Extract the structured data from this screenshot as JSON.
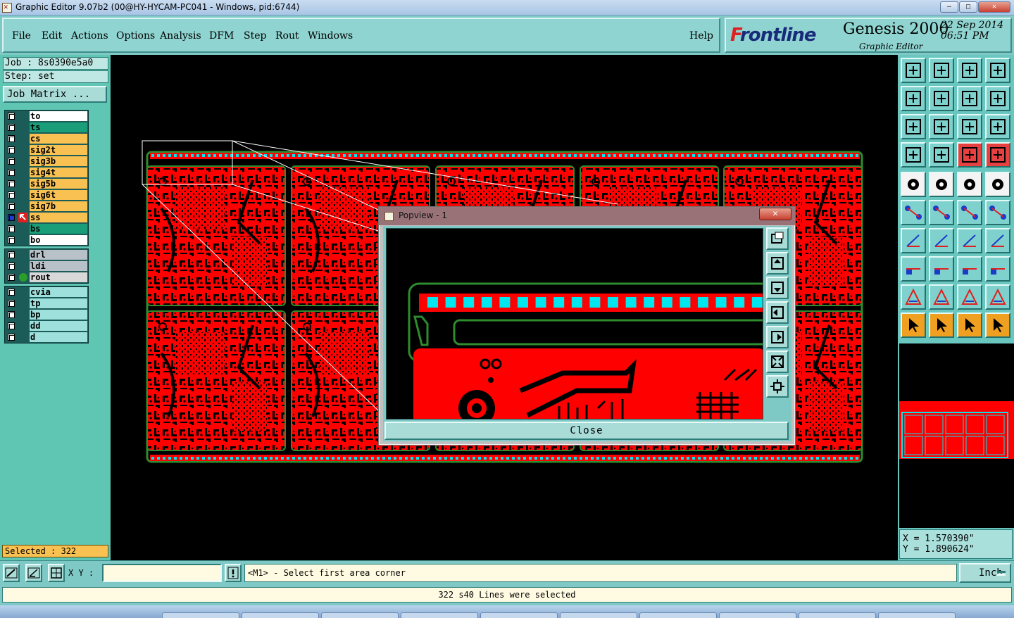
{
  "window": {
    "title": "Graphic Editor 9.07b2 (00@HY-HYCAM-PC041 - Windows, pid:6744)"
  },
  "menu": {
    "items": [
      "File",
      "Edit",
      "Actions",
      "Options",
      "Analysis",
      "DFM",
      "Step",
      "Rout",
      "Windows"
    ],
    "help": "Help"
  },
  "brand": {
    "logo": "Frontline",
    "product": "Genesis 2000",
    "subtitle": "Graphic Editor",
    "date": "22 Sep 2014",
    "time": "06:51 PM"
  },
  "job": {
    "job_label": "Job : 8s0390e5a0",
    "step_label": "Step: set",
    "matrix_button": "Job Matrix ..."
  },
  "layers": {
    "signal": [
      {
        "name": "to",
        "color": "#ffffff"
      },
      {
        "name": "ts",
        "color": "#1a9e7a"
      },
      {
        "name": "cs",
        "color": "#f9c052"
      },
      {
        "name": "sig2t",
        "color": "#f9c052"
      },
      {
        "name": "sig3b",
        "color": "#f9c052"
      },
      {
        "name": "sig4t",
        "color": "#f9c052"
      },
      {
        "name": "sig5b",
        "color": "#f9c052"
      },
      {
        "name": "sig6t",
        "color": "#f9c052"
      },
      {
        "name": "sig7b",
        "color": "#f9c052"
      },
      {
        "name": "ss",
        "color": "#f9c052"
      },
      {
        "name": "bs",
        "color": "#1a9e7a"
      },
      {
        "name": "bo",
        "color": "#ffffff"
      }
    ],
    "drill": [
      {
        "name": "drl",
        "color": "#b8c0c8"
      },
      {
        "name": "ldi",
        "color": "#b8c0c8"
      },
      {
        "name": "rout",
        "color": "#d8d8d8"
      }
    ],
    "misc": [
      {
        "name": "cvia",
        "color": "#9ee0dc"
      },
      {
        "name": "tp",
        "color": "#9ee0dc"
      },
      {
        "name": "bp",
        "color": "#9ee0dc"
      },
      {
        "name": "dd",
        "color": "#9ee0dc"
      },
      {
        "name": "d",
        "color": "#9ee0dc"
      }
    ]
  },
  "selection": {
    "selected_label": "Selected : 322"
  },
  "coords": {
    "x": "X = 1.570390\"",
    "y": "Y = 1.890624\""
  },
  "command": {
    "xy_label": "X Y :",
    "xy_value": "",
    "prompt": "<M1> - Select first area corner",
    "unit": "Inch"
  },
  "status": {
    "message": "322 s40 Lines were selected"
  },
  "popview": {
    "title": "Popview - 1",
    "close_label": "Close"
  },
  "colors": {
    "copper": "#ff0000",
    "panel": "#60c6b4",
    "highlight": "#00e5ee",
    "outline": "#2e8b2e"
  }
}
